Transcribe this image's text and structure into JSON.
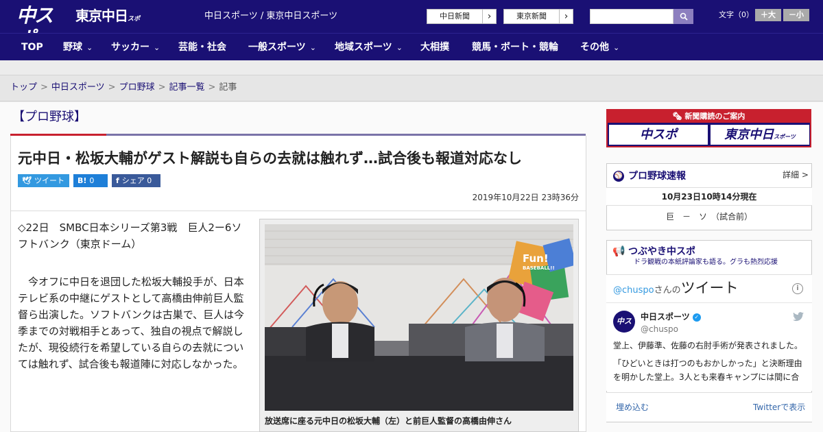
{
  "header": {
    "logo_chuspo": "中スポ",
    "logo_tokyo": "東京中日",
    "logo_tokyo_small": "スポーツ",
    "site_name": "中日スポーツ / 東京中日スポーツ",
    "link_chunichi": "中日新聞",
    "link_tokyo": "東京新聞",
    "arrow": "›",
    "search_icon": "search-icon",
    "fontsize_label": "文字（0）",
    "font_larger": "＋大",
    "font_smaller": "－小"
  },
  "nav": {
    "chevron": "⌄",
    "items": [
      {
        "label": "TOP"
      },
      {
        "label": "野球"
      },
      {
        "label": "サッカー"
      },
      {
        "label": "芸能・社会"
      },
      {
        "label": "一般スポーツ"
      },
      {
        "label": "地域スポーツ"
      },
      {
        "label": "大相撲"
      },
      {
        "label": "競馬・ボート・競輪"
      },
      {
        "label": "その他"
      }
    ]
  },
  "breadcrumb": {
    "items": [
      "トップ",
      "中日スポーツ",
      "プロ野球",
      "記事一覧"
    ],
    "current": "記事",
    "sep": ">"
  },
  "article": {
    "category": "【プロ野球】",
    "headline": "元中日・松坂大輔がゲスト解説も自らの去就は触れず…試合後も報道対応なし",
    "share": {
      "twitter": "ツイート",
      "twitter_icon": "twitter-icon",
      "hatena": "0",
      "hatena_icon": "B!",
      "facebook": "シェア",
      "facebook_count": "0",
      "facebook_icon": "f"
    },
    "date": "2019年10月22日 23時36分",
    "lead": "◇22日　SMBC日本シリーズ第3戦　巨人2ー6ソフトバンク（東京ドーム）",
    "body": "今オフに中日を退団した松坂大輔投手が、日本テレビ系の中継にゲストとして高橋由伸前巨人監督ら出演した。ソフトバンクは古巣で、巨人は今季までの対戦相手とあって、独自の視点で解説したが、現役続行を希望している自らの去就については触れず、試合後も報道陣に対応しなかった。",
    "photo_sign": "Fun! BASEBALL!!",
    "caption": "放送席に座る元中日の松坂大輔（左）と前巨人監督の高橋由伸さん"
  },
  "sidebar": {
    "subscribe": {
      "title": "新聞購読のご案内",
      "btn_chuspo": "中スポ",
      "btn_tokyo": "東京中日",
      "btn_tokyo_small": "スポーツ"
    },
    "scores": {
      "title": "プロ野球速報",
      "detail": "詳細 >",
      "time": "10月23日10時14分現在",
      "line": "巨　－　ソ　（試合前）"
    },
    "tweets": {
      "title": "つぶやき中スポ",
      "subtitle": "ドラ観戦の本紙評論家も語る。グラも熱烈応援",
      "handle_link": "@chuspo",
      "handle_suffix": "さんの",
      "heading_big": "ツイート",
      "info": "i",
      "account_name": "中日スポーツ",
      "account_handle": "@chuspo",
      "avatar_text": "中スポ",
      "verified": "✓",
      "text1": "堂上、伊藤準、佐藤の右肘手術が発表されました。",
      "text2": "「ひどいときは打つのもおかしかった」と決断理由を明かした堂上。3人とも来春キャンプには間に合",
      "embed": "埋め込む",
      "view": "Twitterで表示"
    }
  },
  "colors": {
    "brand_navy": "#1a1074",
    "accent_red": "#c8202e",
    "twitter_blue": "#3399e0"
  }
}
